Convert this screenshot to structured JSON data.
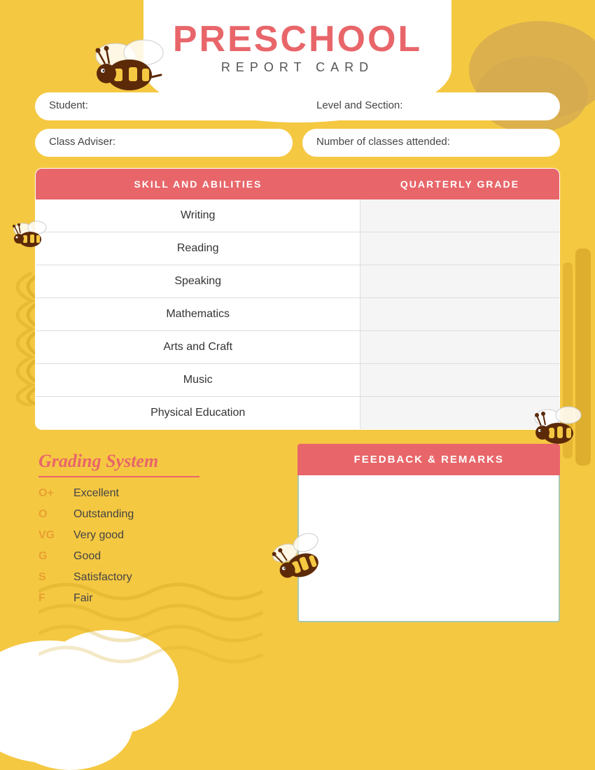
{
  "header": {
    "title_main": "PRESCHOOL",
    "title_sub": "REPORT CARD"
  },
  "form": {
    "student_label": "Student:",
    "level_label": "Level and Section:",
    "adviser_label": "Class Adviser:",
    "classes_label": "Number of classes attended:"
  },
  "table": {
    "col1": "SKILL AND ABILITIES",
    "col2": "QUARTERLY GRADE",
    "rows": [
      "Writing",
      "Reading",
      "Speaking",
      "Mathematics",
      "Arts and Craft",
      "Music",
      "Physical Education"
    ]
  },
  "grading": {
    "title": "Grading System",
    "items": [
      {
        "code": "O+",
        "label": "Excellent"
      },
      {
        "code": "O",
        "label": "Outstanding"
      },
      {
        "code": "VG",
        "label": "Very good"
      },
      {
        "code": "G",
        "label": "Good"
      },
      {
        "code": "S",
        "label": "Satisfactory"
      },
      {
        "code": "F",
        "label": "Fair"
      }
    ]
  },
  "feedback": {
    "header": "FEEDBACK & REMARKS",
    "body": ""
  }
}
